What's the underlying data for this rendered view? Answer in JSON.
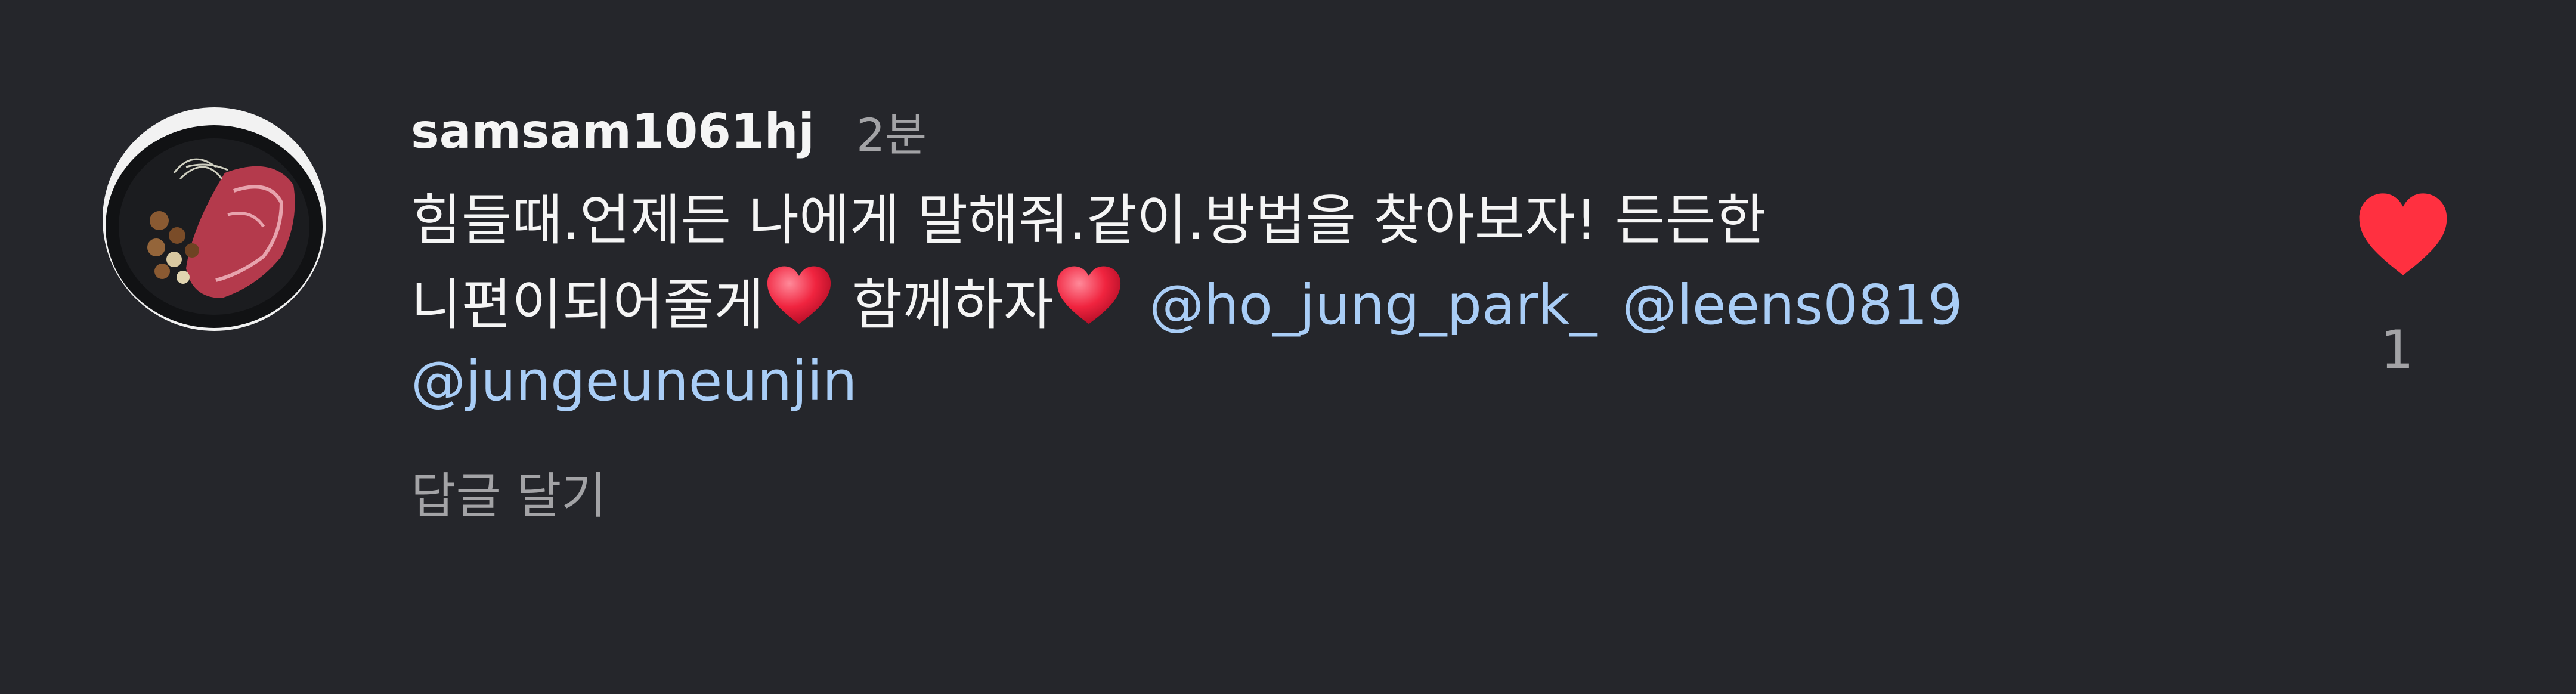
{
  "comment": {
    "username": "samsam1061hj",
    "time": "2분",
    "text_line1": "힘들때.언제든 나에게 말해줘.같이.방법을 찾아보자! 든든한",
    "text_line2_part1": "니편이되어줄게",
    "text_line2_part2": " 함께하자",
    "mentions": [
      "@ho_jung_park_",
      "@leens0819",
      "@jungeuneunjin"
    ],
    "reply_label": "답글 달기",
    "like_count": "1"
  },
  "colors": {
    "background": "#25262b",
    "text": "#f5f5f5",
    "muted": "#a3a3a6",
    "mention": "#a9cdf6",
    "like": "#ff3040"
  },
  "icons": {
    "avatar": "steak-plate-avatar",
    "emoji": "red-heart-emoji",
    "like": "heart-icon"
  }
}
